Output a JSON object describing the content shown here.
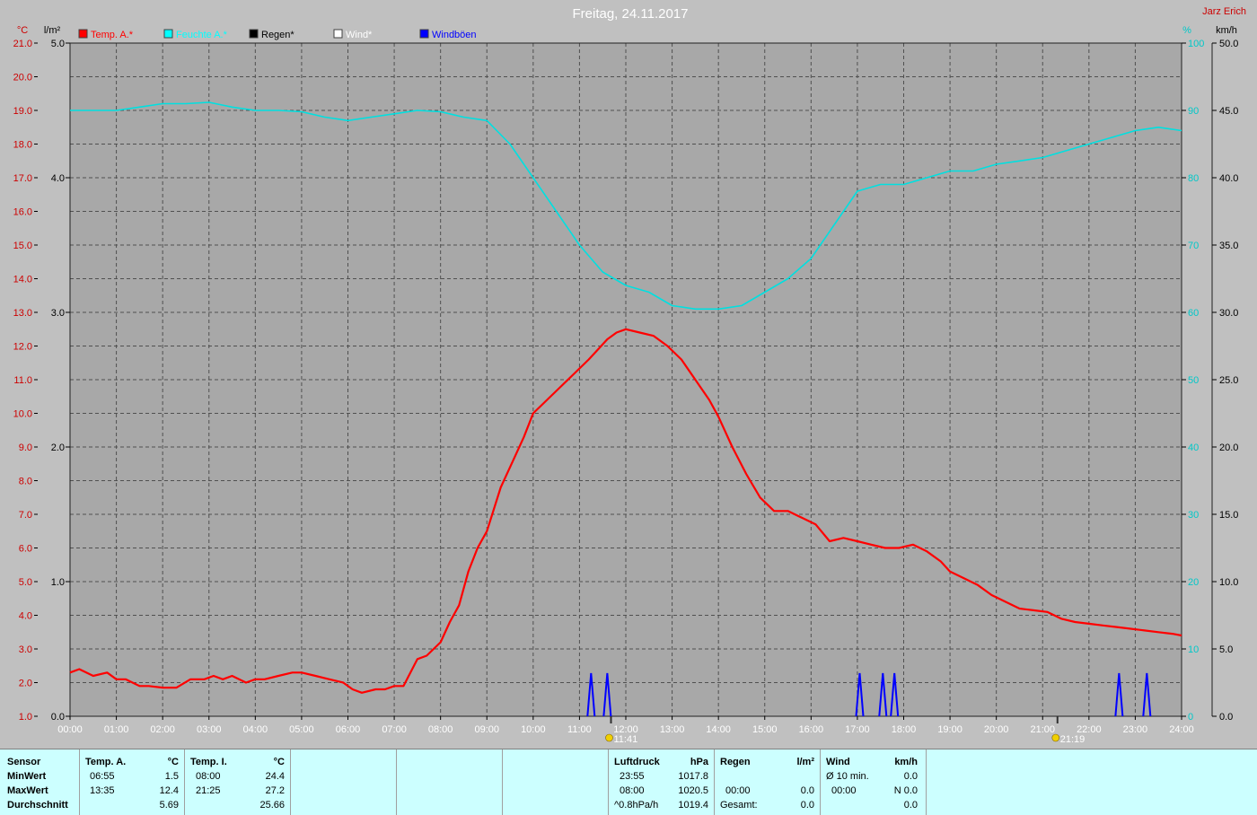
{
  "header": {
    "title": "Freitag, 24.11.2017",
    "author": "Jarz Erich",
    "unit_temp": "°C",
    "unit_rain": "l/m²",
    "unit_humidity": "%",
    "unit_wind": "km/h"
  },
  "legend": [
    {
      "label": "Temp. A.*",
      "color": "#ff0000"
    },
    {
      "label": "Feuchte A.*",
      "color": "#00ffff"
    },
    {
      "label": "Regen*",
      "color": "#000000"
    },
    {
      "label": "Wind*",
      "color": "#ffffff"
    },
    {
      "label": "Windböen",
      "color": "#0000ff"
    }
  ],
  "chart_data": {
    "type": "line",
    "x_ticks": [
      "00:00",
      "01:00",
      "02:00",
      "03:00",
      "04:00",
      "05:00",
      "06:00",
      "07:00",
      "08:00",
      "09:00",
      "10:00",
      "11:00",
      "12:00",
      "13:00",
      "14:00",
      "15:00",
      "16:00",
      "17:00",
      "18:00",
      "19:00",
      "20:00",
      "21:00",
      "22:00",
      "23:00",
      "24:00"
    ],
    "axes": {
      "temp": {
        "label": "°C",
        "min": 1.0,
        "max": 21.0,
        "ticks": [
          "1.0",
          "2.0",
          "3.0",
          "4.0",
          "5.0",
          "6.0",
          "7.0",
          "8.0",
          "9.0",
          "10.0",
          "11.0",
          "12.0",
          "13.0",
          "14.0",
          "15.0",
          "16.0",
          "17.0",
          "18.0",
          "19.0",
          "20.0",
          "21.0"
        ]
      },
      "rain": {
        "label": "l/m²",
        "min": 0.0,
        "max": 5.0,
        "ticks": [
          "0.0",
          "1.0",
          "2.0",
          "3.0",
          "4.0",
          "5.0"
        ]
      },
      "humidity": {
        "label": "%",
        "min": 0,
        "max": 100,
        "ticks": [
          "0",
          "10",
          "20",
          "30",
          "40",
          "50",
          "60",
          "70",
          "80",
          "90",
          "100"
        ]
      },
      "wind": {
        "label": "km/h",
        "min": 0.0,
        "max": 50.0,
        "ticks": [
          "0.0",
          "5.0",
          "10.0",
          "15.0",
          "20.0",
          "25.0",
          "30.0",
          "35.0",
          "40.0",
          "45.0",
          "50.0"
        ]
      }
    },
    "grid": true,
    "series": [
      {
        "name": "Temp. A.*",
        "axis": "temp",
        "color": "#ff0000",
        "x": [
          0,
          0.2,
          0.5,
          0.8,
          1.0,
          1.2,
          1.5,
          1.7,
          2.0,
          2.3,
          2.6,
          2.9,
          3.1,
          3.3,
          3.5,
          3.8,
          4.0,
          4.2,
          4.5,
          4.8,
          5.0,
          5.3,
          5.6,
          5.9,
          6.1,
          6.3,
          6.6,
          6.8,
          7.0,
          7.2,
          7.5,
          7.7,
          8.0,
          8.2,
          8.4,
          8.6,
          8.8,
          9.0,
          9.3,
          9.6,
          9.8,
          10.0,
          10.3,
          10.6,
          10.9,
          11.2,
          11.4,
          11.6,
          11.8,
          12.0,
          12.3,
          12.6,
          12.9,
          13.2,
          13.5,
          13.8,
          14.0,
          14.3,
          14.6,
          14.9,
          15.2,
          15.5,
          15.8,
          16.1,
          16.4,
          16.7,
          17.0,
          17.3,
          17.6,
          17.9,
          18.2,
          18.5,
          18.8,
          19.0,
          19.3,
          19.6,
          19.9,
          20.2,
          20.5,
          20.8,
          21.1,
          21.4,
          21.7,
          22.0,
          22.3,
          22.6,
          22.9,
          23.2,
          23.5,
          23.8,
          24.0
        ],
        "y": [
          2.3,
          2.4,
          2.2,
          2.3,
          2.1,
          2.1,
          1.9,
          1.9,
          1.85,
          1.85,
          2.1,
          2.1,
          2.2,
          2.1,
          2.2,
          2.0,
          2.1,
          2.1,
          2.2,
          2.3,
          2.3,
          2.2,
          2.1,
          2.0,
          1.8,
          1.7,
          1.8,
          1.8,
          1.9,
          1.9,
          2.7,
          2.8,
          3.2,
          3.8,
          4.3,
          5.3,
          6.0,
          6.5,
          7.8,
          8.7,
          9.3,
          10.0,
          10.4,
          10.8,
          11.2,
          11.6,
          11.9,
          12.2,
          12.4,
          12.5,
          12.4,
          12.3,
          12.0,
          11.6,
          11.0,
          10.4,
          9.9,
          9.0,
          8.2,
          7.5,
          7.1,
          7.1,
          6.9,
          6.7,
          6.2,
          6.3,
          6.2,
          6.1,
          6.0,
          6.0,
          6.1,
          5.9,
          5.6,
          5.3,
          5.1,
          4.9,
          4.6,
          4.4,
          4.2,
          4.15,
          4.1,
          3.9,
          3.8,
          3.75,
          3.7,
          3.65,
          3.6,
          3.55,
          3.5,
          3.45,
          3.4
        ]
      },
      {
        "name": "Feuchte A.*",
        "axis": "humidity",
        "color": "#00e0e0",
        "x": [
          0,
          0.5,
          1.0,
          1.5,
          2.0,
          2.5,
          3.0,
          3.5,
          4.0,
          4.5,
          5.0,
          5.5,
          6.0,
          6.5,
          7.0,
          7.5,
          8.0,
          8.5,
          9.0,
          9.5,
          10.0,
          10.5,
          11.0,
          11.5,
          12.0,
          12.5,
          13.0,
          13.5,
          14.0,
          14.5,
          15.0,
          15.5,
          16.0,
          16.5,
          17.0,
          17.5,
          18.0,
          18.5,
          19.0,
          19.5,
          20.0,
          20.5,
          21.0,
          21.5,
          22.0,
          22.5,
          23.0,
          23.5,
          24.0
        ],
        "y": [
          90,
          90,
          90,
          90.5,
          91,
          91,
          91.2,
          90.5,
          90,
          90,
          89.8,
          89,
          88.5,
          89,
          89.5,
          90,
          89.8,
          89,
          88.5,
          85,
          80,
          75,
          70,
          66,
          64,
          63,
          61,
          60.5,
          60.5,
          61,
          63,
          65,
          68,
          73,
          78,
          79,
          79,
          80,
          81,
          81,
          82,
          82.5,
          83,
          84,
          85,
          86,
          87,
          87.5,
          87
        ]
      },
      {
        "name": "Windböen",
        "axis": "wind",
        "color": "#0000ff",
        "gust_times": [
          11.25,
          11.6,
          17.05,
          17.55,
          17.8,
          22.65,
          23.25
        ],
        "gust_value": 1.6
      }
    ],
    "markers": [
      {
        "label": "11:41",
        "hour": 11.68
      },
      {
        "label": "21:19",
        "hour": 21.32
      }
    ]
  },
  "panel": {
    "sensor": {
      "title": "Sensor",
      "rows": [
        "MinWert",
        "MaxWert",
        "Durchschnitt"
      ]
    },
    "temp_a": {
      "title": "Temp. A.",
      "unit": "°C",
      "times": [
        "06:55",
        "13:35",
        ""
      ],
      "values": [
        "1.5",
        "12.4",
        "5.69"
      ]
    },
    "temp_i": {
      "title": "Temp. I.",
      "unit": "°C",
      "times": [
        "08:00",
        "21:25",
        ""
      ],
      "values": [
        "24.4",
        "27.2",
        "25.66"
      ]
    },
    "pressure": {
      "title": "Luftdruck",
      "unit": "hPa",
      "times": [
        "23:55",
        "08:00",
        "^0.8hPa/h"
      ],
      "values": [
        "1017.8",
        "1020.5",
        "1019.4"
      ]
    },
    "rain": {
      "title": "Regen",
      "unit": "l/m²",
      "times": [
        "",
        "00:00",
        "Gesamt:"
      ],
      "values": [
        "",
        "0.0",
        "0.0"
      ]
    },
    "wind": {
      "title": "Wind",
      "unit": "km/h",
      "times": [
        "Ø 10 min.",
        "00:00",
        ""
      ],
      "values": [
        "0.0",
        "N 0.0",
        "0.0"
      ]
    }
  }
}
